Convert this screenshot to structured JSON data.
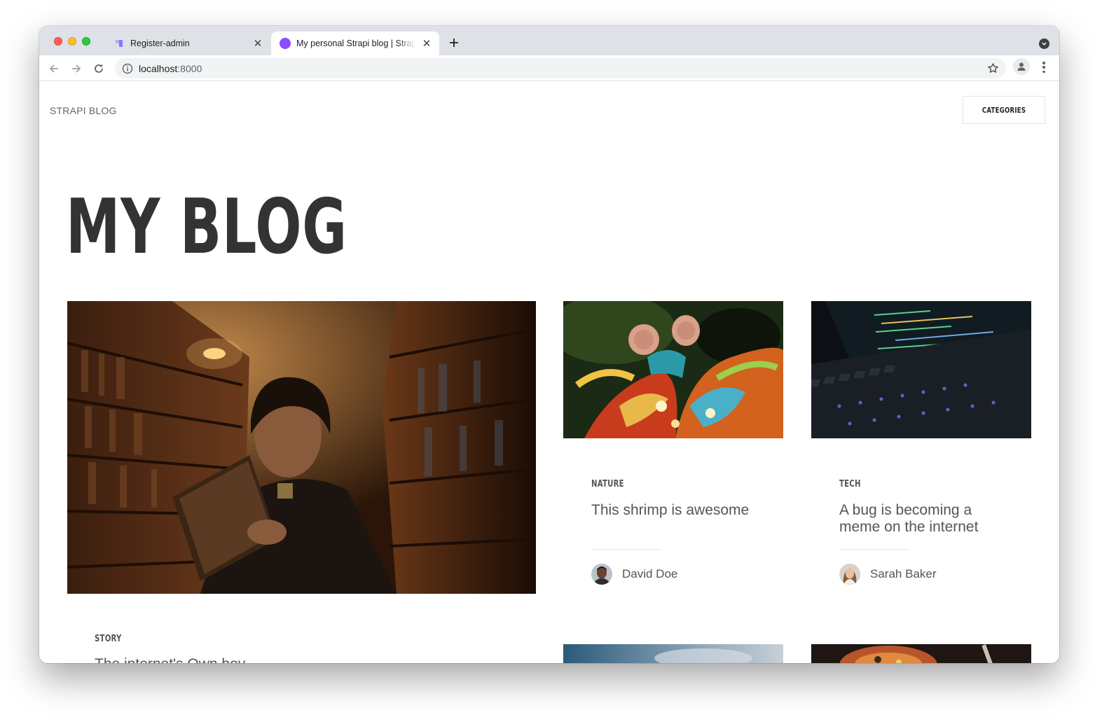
{
  "browser": {
    "tabs": [
      {
        "title": "Register-admin",
        "active": false
      },
      {
        "title": "My personal Strapi blog | Strapi",
        "active": true
      }
    ],
    "url_host": "localhost",
    "url_port": ":8000"
  },
  "site": {
    "brand": "STRAPI BLOG",
    "categories_button": "CATEGORIES",
    "hero_title": "MY BLOG"
  },
  "articles": [
    {
      "category": "NATURE",
      "title": "This shrimp is awesome",
      "author": "David Doe"
    },
    {
      "category": "TECH",
      "title": "A bug is becoming a meme on the internet",
      "author": "Sarah Baker"
    },
    {
      "category": "STORY",
      "title": "The internet's Own boy"
    }
  ],
  "colors": {
    "accent_favicon": "#8c4bff",
    "strapi_favicon": "#8e75ff",
    "text": "#555555",
    "hero": "#333333"
  }
}
